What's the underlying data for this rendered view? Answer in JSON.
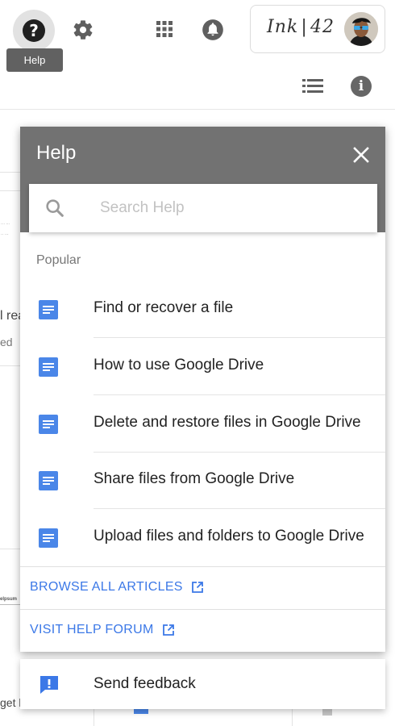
{
  "topbar": {
    "help_tooltip": "Help",
    "brand": "Ink | 42",
    "icons": [
      "help-icon",
      "gear-icon",
      "apps-grid-icon",
      "notifications-icon",
      "list-view-icon",
      "info-icon"
    ]
  },
  "background": {
    "text_fragments": [
      "l rea",
      "ed",
      "get l"
    ],
    "thumbnail_text": "elpsum"
  },
  "help_panel": {
    "title": "Help",
    "search_placeholder": "Search Help",
    "popular_label": "Popular",
    "articles": [
      "Find or recover a file",
      "How to use Google Drive",
      "Delete and restore files in Google Drive",
      "Share files from Google Drive",
      "Upload files and folders to Google Drive"
    ],
    "links": {
      "browse_all": "BROWSE ALL ARTICLES",
      "help_forum": "VISIT HELP FORUM"
    },
    "feedback_label": "Send feedback"
  },
  "colors": {
    "header_bg": "#727272",
    "link_blue": "#3b78e7",
    "doc_icon_blue": "#4a86e8"
  }
}
